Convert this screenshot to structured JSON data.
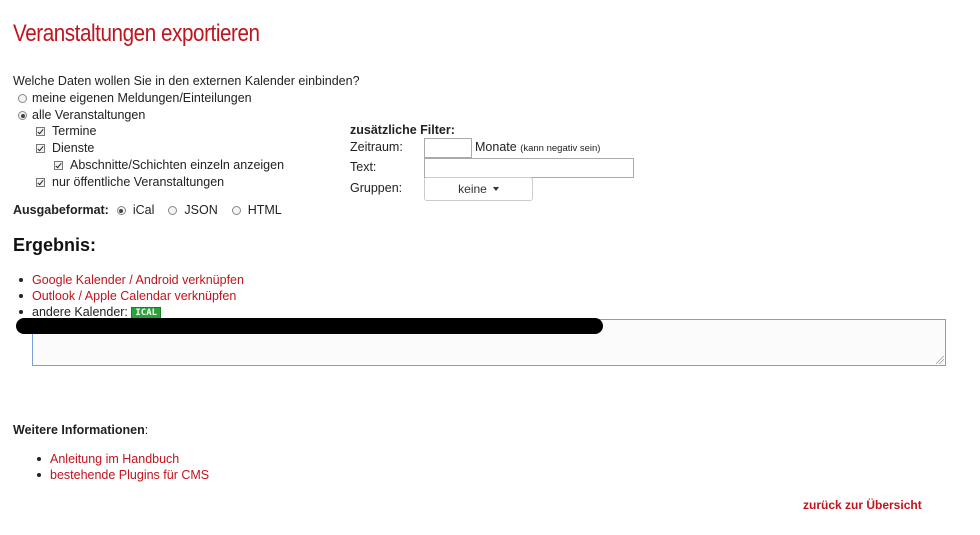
{
  "page": {
    "title": "Veranstaltungen exportieren",
    "question": "Welche Daten wollen Sie in den externen Kalender einbinden?"
  },
  "scope": {
    "own_label": "meine eigenen Meldungen/Einteilungen",
    "own_selected": false,
    "all_label": "alle Veranstaltungen",
    "all_selected": true,
    "checks": {
      "termine": {
        "label": "Termine",
        "checked": true
      },
      "dienste": {
        "label": "Dienste",
        "checked": true
      },
      "abschnitte": {
        "label": "Abschnitte/Schichten einzeln anzeigen",
        "checked": true
      },
      "oeffentlich": {
        "label": "nur öffentliche Veranstaltungen",
        "checked": true
      }
    }
  },
  "filters": {
    "heading": "zusätzliche Filter:",
    "zeitraum_label": "Zeitraum:",
    "zeitraum_value": "",
    "monate_label": "Monate",
    "monate_hint": "(kann negativ sein)",
    "text_label": "Text:",
    "text_value": "",
    "gruppen_label": "Gruppen:",
    "gruppen_value": "keine"
  },
  "format": {
    "label": "Ausgabeformat:",
    "options": [
      {
        "label": "iCal",
        "selected": true
      },
      {
        "label": "JSON",
        "selected": false
      },
      {
        "label": "HTML",
        "selected": false
      }
    ]
  },
  "result": {
    "heading": "Ergebnis:",
    "links": [
      "Google Kalender / Android verknüpfen",
      "Outlook / Apple Calendar verknüpfen"
    ],
    "other_label": "andere Kalender:",
    "ical_badge": "ICAL",
    "url_value": ""
  },
  "info": {
    "heading": "Weitere Informationen",
    "colon": ":",
    "links": [
      "Anleitung im Handbuch",
      "bestehende Plugins für CMS"
    ]
  },
  "footer": {
    "back_label": "zurück zur Übersicht"
  },
  "colors": {
    "accent": "#c0141e",
    "badge": "#29a33a"
  }
}
